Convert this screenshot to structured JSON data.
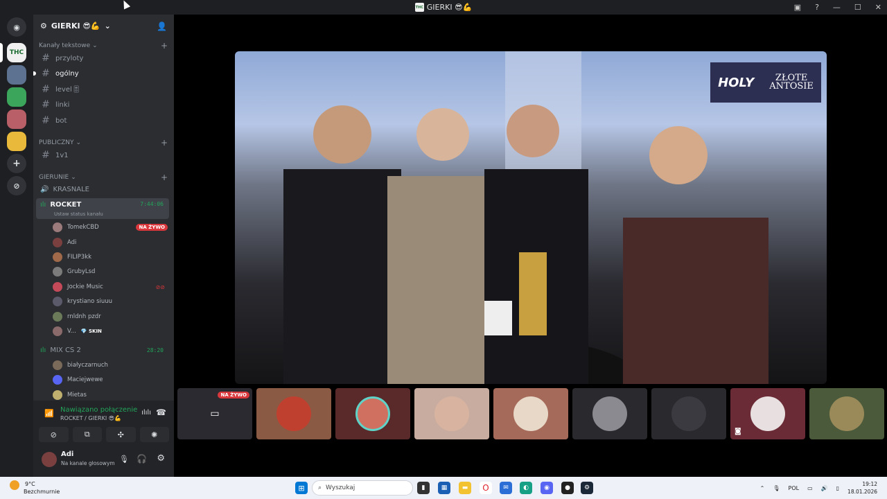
{
  "window": {
    "title": "GIERKI 😎💪",
    "thc_label": "THC",
    "help_icon": "?"
  },
  "server": {
    "name": "GIERKI 😎💪"
  },
  "categories": {
    "text": "Kanały tekstowe",
    "public": "PUBLICZNY",
    "games": "GIERUNIE"
  },
  "text_channels": [
    "przyloty",
    "ogólny",
    "level🎚",
    "linki",
    "bot"
  ],
  "public_channels": [
    "1v1"
  ],
  "voice_channels": {
    "krasnale": "KRASNALE",
    "rocket": {
      "name": "ROCKET",
      "timer": "7:44:06",
      "status": "Ustaw status kanału"
    },
    "mix": {
      "name": "MIX CS 2",
      "timer": "28:20"
    }
  },
  "rocket_members": [
    {
      "name": "TomekCBD",
      "badge": "NA ŻYWO"
    },
    {
      "name": "Adi"
    },
    {
      "name": "FILIP3kk"
    },
    {
      "name": "GrubyLsd"
    },
    {
      "name": "Jockie Music"
    },
    {
      "name": "krystiano siuuu"
    },
    {
      "name": "rnldnh pzdr"
    },
    {
      "name": "V...",
      "tag": "💎 SKIN"
    }
  ],
  "mix_members": [
    "białyczarnuch",
    "Maciejwewe",
    "Mietas"
  ],
  "voice_panel": {
    "state": "Nawiązano połączenie",
    "channel": "ROCKET / GIERKI 😎💪"
  },
  "user": {
    "name": "Adi",
    "status": "Na kanale głosowym"
  },
  "stream": {
    "logo_main": "HOLY",
    "logo_line1": "ZŁOTE",
    "logo_line2": "ANTOSIE",
    "live_label": "NA ŻYWO"
  },
  "taskbar": {
    "temperature": "9°C",
    "condition": "Bezchmurnie",
    "search_placeholder": "Wyszukaj",
    "language": "POL",
    "time": "19:12",
    "date": "18.01.2026"
  },
  "colors": {
    "live": "#da373c",
    "connected": "#23a55a",
    "sidebar": "#2b2d31",
    "rail": "#1e1f22"
  }
}
